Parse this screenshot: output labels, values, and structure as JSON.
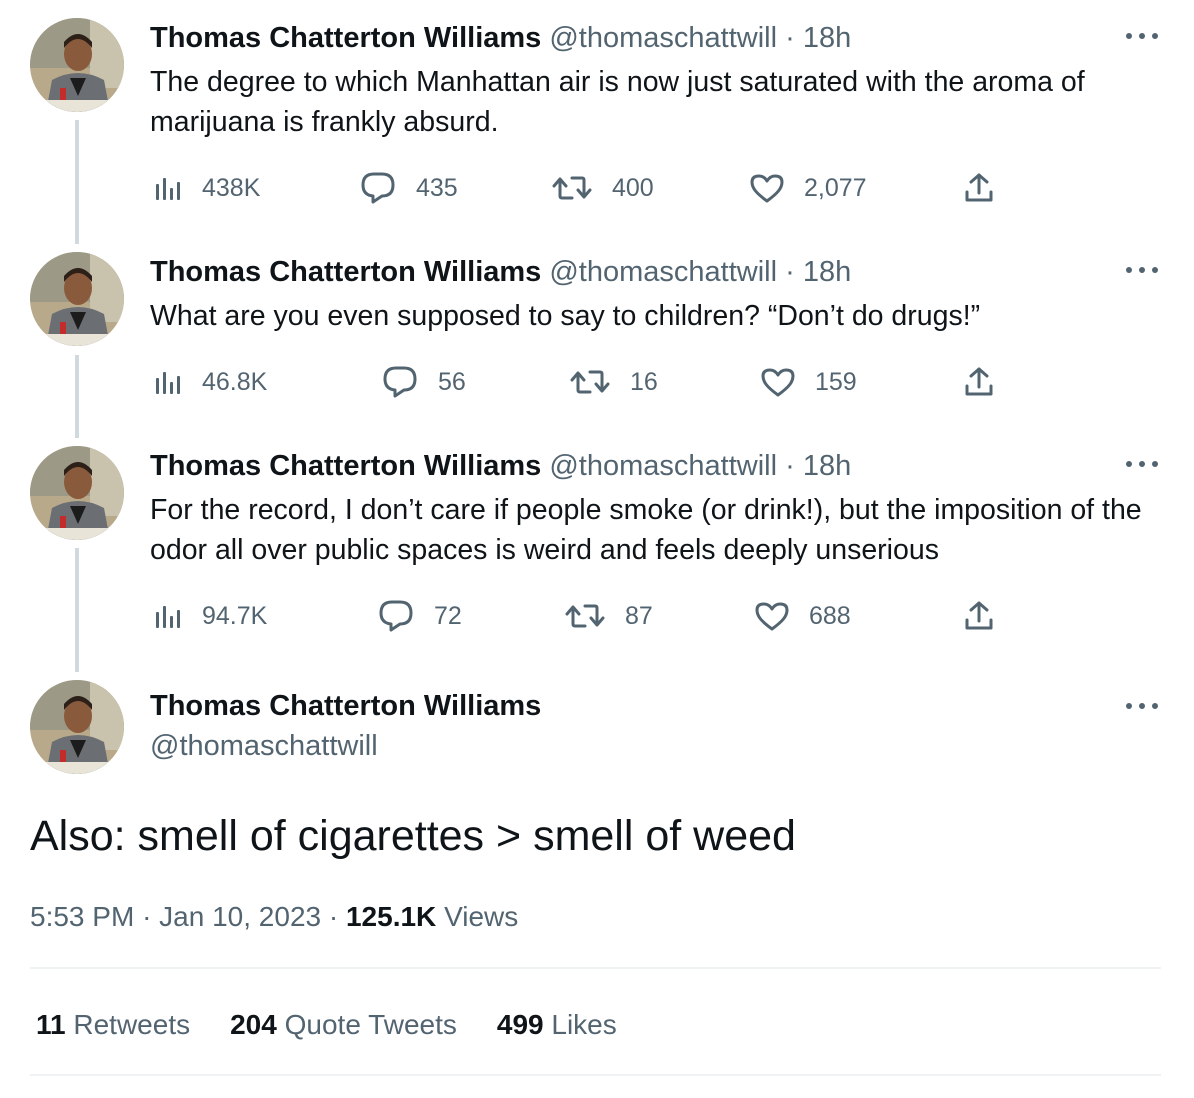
{
  "author": {
    "name": "Thomas Chatterton Williams",
    "handle": "@thomaschattwill"
  },
  "thread": [
    {
      "time": "18h",
      "text": "The degree to which Manhattan air is now just saturated with the aroma of marijuana is frankly absurd.",
      "views": "438K",
      "replies": "435",
      "retweets": "400",
      "likes": "2,077"
    },
    {
      "time": "18h",
      "text": "What are you even supposed to say to children? “Don’t do drugs!”",
      "views": "46.8K",
      "replies": "56",
      "retweets": "16",
      "likes": "159"
    },
    {
      "time": "18h",
      "text": "For the record, I don’t care if people smoke (or drink!), but the imposition of the odor all over public spaces is weird and feels deeply unserious",
      "views": "94.7K",
      "replies": "72",
      "retweets": "87",
      "likes": "688"
    }
  ],
  "main_tweet": {
    "text": "Also: smell of cigarettes > smell of weed",
    "time": "5:53 PM",
    "date": "Jan 10, 2023",
    "views_count": "125.1K",
    "views_label": "Views",
    "separator": "·"
  },
  "stats": {
    "retweets_count": "11",
    "retweets_label": "Retweets",
    "quotes_count": "204",
    "quotes_label": "Quote Tweets",
    "likes_count": "499",
    "likes_label": "Likes"
  },
  "icons": {
    "views": "bar-chart-icon",
    "reply": "speech-bubble-icon",
    "retweet": "retweet-arrows-icon",
    "like": "heart-icon",
    "share": "share-upload-icon",
    "more": "more-dots-icon"
  },
  "colors": {
    "text": "#0f1419",
    "secondary": "#536471",
    "thread_line": "#cfd9de",
    "divider": "#eff3f4"
  }
}
